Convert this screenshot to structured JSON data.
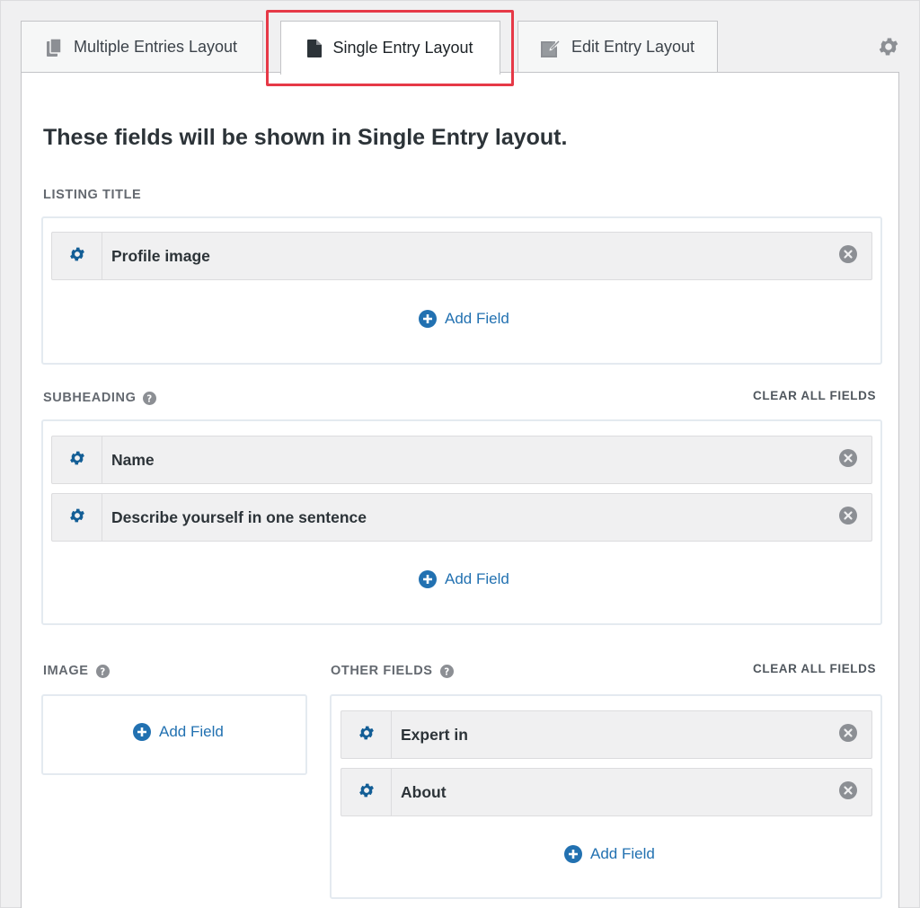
{
  "tabs": {
    "multiple": {
      "label": "Multiple Entries Layout",
      "icon": "copy-icon"
    },
    "single": {
      "label": "Single Entry Layout",
      "icon": "document-icon",
      "active": true
    },
    "edit": {
      "label": "Edit Entry Layout",
      "icon": "edit-document-icon"
    }
  },
  "settings_icon": "gear-icon",
  "page_title": "These fields will be shown in Single Entry layout.",
  "sections": {
    "listing_title": {
      "label": "LISTING TITLE",
      "fields": [
        {
          "label": "Profile image"
        }
      ],
      "add_field_label": "Add Field"
    },
    "subheading": {
      "label": "SUBHEADING",
      "clear_all_label": "CLEAR ALL FIELDS",
      "fields": [
        {
          "label": "Name"
        },
        {
          "label": "Describe yourself in one sentence"
        }
      ],
      "add_field_label": "Add Field"
    },
    "image": {
      "label": "IMAGE",
      "fields": [],
      "add_field_label": "Add Field"
    },
    "other_fields": {
      "label": "OTHER FIELDS",
      "clear_all_label": "CLEAR ALL FIELDS",
      "fields": [
        {
          "label": "Expert in"
        },
        {
          "label": "About"
        }
      ],
      "add_field_label": "Add Field"
    }
  },
  "colors": {
    "accent_blue": "#2271b1",
    "highlight_red": "#e63947",
    "gear_blue": "#135e96"
  }
}
